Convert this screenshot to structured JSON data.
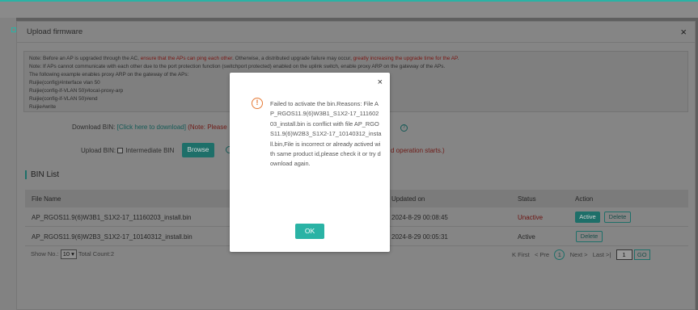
{
  "dialog": {
    "title": "Upload firmware",
    "close": "×"
  },
  "note": {
    "line1_a": "Note: Before an AP is upgraded through the AC, ",
    "line1_b": "ensure that the APs can ping each other",
    "line1_c": ". Otherwise, a distributed upgrade failure may occur, ",
    "line1_d": "greatly increasing the upgrade time for the AP",
    "line1_e": ".",
    "line2": "Note: If APs cannot communicate with each other due to the port protection function (switchport protected) enabled on the uplink switch, enable proxy ARP on the gateway of the APs.",
    "line3": "The following example enables proxy ARP on the gateway of the APs:",
    "line4": "Ruijie(config)#interface vlan 50",
    "line5": "Ruijie(config-if-VLAN 50)#local-proxy-arp",
    "line6": "Ruijie(config-if-VLAN 50)#end",
    "line7": "Ruijie#write"
  },
  "download": {
    "label": "Download BIN:",
    "link": "[Click here to download]",
    "note": "(Note: Please"
  },
  "upload": {
    "label": "Upload BIN:",
    "intermediate": "Intermediate BIN",
    "browse": "Browse",
    "warning_tail": "d operation starts.)"
  },
  "bin_list": {
    "title": "BIN List",
    "headers": {
      "file_name": "File Name",
      "updated": "Updated on",
      "status": "Status",
      "action": "Action"
    },
    "rows": [
      {
        "file": "AP_RGOS11.9(6)W3B1_S1X2-17_11160203_install.bin",
        "updated": "2024-8-29 00:08:45",
        "status": "Unactive",
        "active": "Active",
        "delete": "Delete"
      },
      {
        "file": "AP_RGOS11.9(6)W2B3_S1X2-17_10140312_install.bin",
        "updated": "2024-8-29 00:05:31",
        "status": "Active",
        "delete": "Delete"
      }
    ]
  },
  "pager": {
    "show_no": "Show No.:",
    "page_size": "10",
    "total": "Total Count:2",
    "first": "K First",
    "prev": "< Pre",
    "current": "1",
    "next": "Next >",
    "last": "Last >|",
    "page_input": "1",
    "go": "GO"
  },
  "modal": {
    "close": "×",
    "icon": "!",
    "message": "Failed to activate the bin.Reasons: File AP_RGOS11.9(6)W3B1_S1X2-17_11160203_install.bin is conflict with file AP_RGOS11.9(6)W2B3_S1X2-17_10140312_install.bin,File is incorrect or already actived with same product id,please check it or try download again.",
    "ok": "OK"
  },
  "colors": {
    "accent": "#2ab3a5",
    "warning_icon": "#e57b36",
    "overlay": "#5f5f5f"
  }
}
